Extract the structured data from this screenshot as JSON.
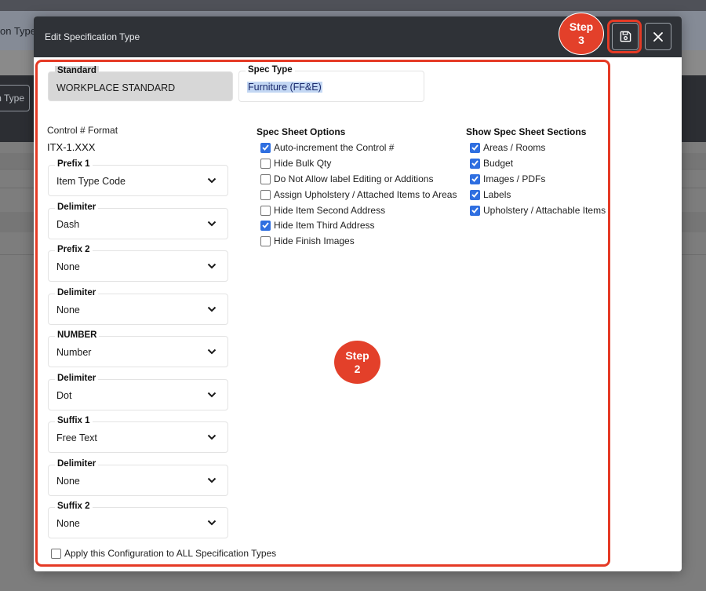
{
  "background": {
    "band_text": "on Type",
    "button_label": "n Type"
  },
  "modal": {
    "title": "Edit Specification Type",
    "save_button_icon": "floppy-disk-icon",
    "close_button_icon": "close-icon"
  },
  "standard": {
    "label": "Standard",
    "value": "WORKPLACE STANDARD"
  },
  "spec_type": {
    "label": "Spec Type",
    "value": "Furniture (FF&E)"
  },
  "control_format": {
    "label": "Control # Format",
    "value": "ITX-1.XXX"
  },
  "format_fields": [
    {
      "label": "Prefix 1",
      "value": "Item Type Code"
    },
    {
      "label": "Delimiter",
      "value": "Dash"
    },
    {
      "label": "Prefix 2",
      "value": "None"
    },
    {
      "label": "Delimiter",
      "value": "None"
    },
    {
      "label": "NUMBER",
      "value": "Number"
    },
    {
      "label": "Delimiter",
      "value": "Dot"
    },
    {
      "label": "Suffix 1",
      "value": "Free Text"
    },
    {
      "label": "Delimiter",
      "value": "None"
    },
    {
      "label": "Suffix 2",
      "value": "None"
    }
  ],
  "spec_sheet_options": {
    "title": "Spec Sheet Options",
    "items": [
      {
        "label": "Auto-increment the Control #",
        "checked": true
      },
      {
        "label": "Hide Bulk Qty",
        "checked": false
      },
      {
        "label": "Do Not Allow label Editing or Additions",
        "checked": false
      },
      {
        "label": "Assign Upholstery / Attached Items to Areas",
        "checked": false
      },
      {
        "label": "Hide Item Second Address",
        "checked": false
      },
      {
        "label": "Hide Item Third Address",
        "checked": true
      },
      {
        "label": "Hide Finish Images",
        "checked": false
      }
    ]
  },
  "spec_sheet_sections": {
    "title": "Show Spec Sheet Sections",
    "items": [
      {
        "label": "Areas / Rooms",
        "checked": true
      },
      {
        "label": "Budget",
        "checked": true
      },
      {
        "label": "Images / PDFs",
        "checked": true
      },
      {
        "label": "Labels",
        "checked": true
      },
      {
        "label": "Upholstery / Attachable Items",
        "checked": true
      }
    ]
  },
  "apply_all": {
    "label": "Apply this Configuration to ALL Specification Types",
    "checked": false
  },
  "callouts": {
    "step3": {
      "line1": "Step",
      "line2": "3"
    },
    "step2": {
      "line1": "Step",
      "line2": "2"
    }
  },
  "colors": {
    "callout_red": "#e53a25",
    "header_dark": "#2f3237",
    "checkbox_blue": "#2f6fe0"
  }
}
